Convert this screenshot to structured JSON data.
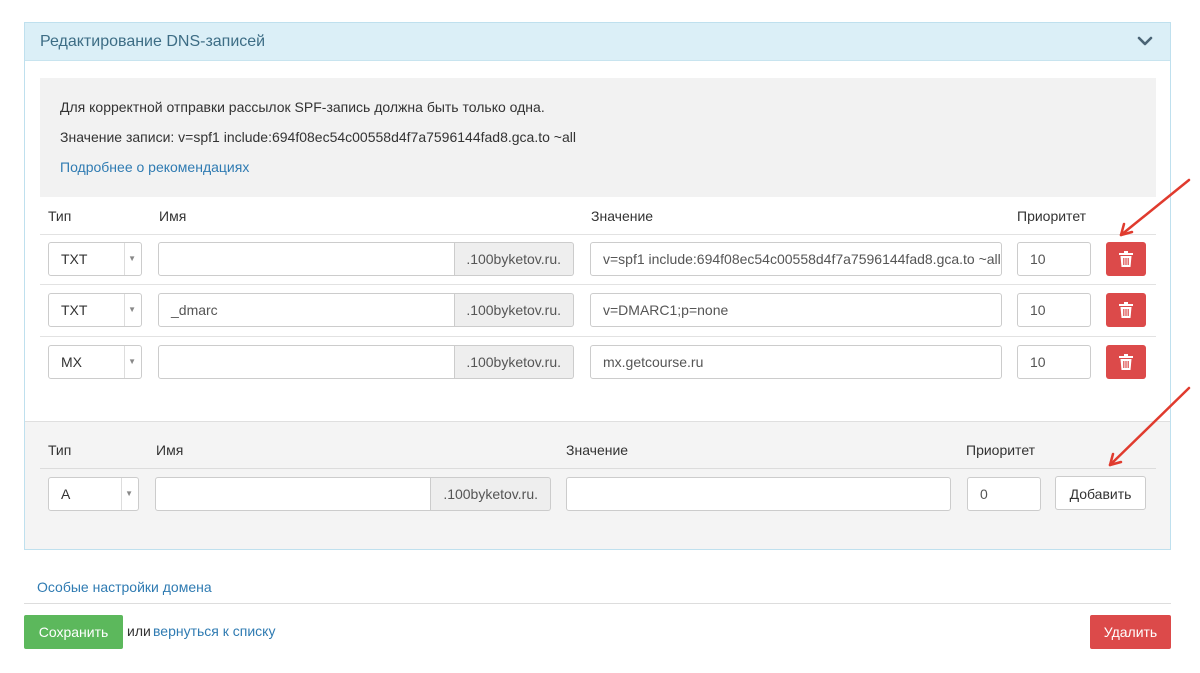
{
  "panel": {
    "title": "Редактирование DNS-записей"
  },
  "info": {
    "line1": "Для корректной отправки рассылок SPF-запись должна быть только одна.",
    "line2": "Значение записи: v=spf1 include:694f08ec54c00558d4f7a7596144fad8.gca.to ~all",
    "link": "Подробнее о рекомендациях"
  },
  "table": {
    "headers": {
      "type": "Тип",
      "name": "Имя",
      "value": "Значение",
      "priority": "Приоритет"
    },
    "domain_suffix": ".100byketov.ru.",
    "rows": [
      {
        "type": "TXT",
        "name": "",
        "value": "v=spf1 include:694f08ec54c00558d4f7a7596144fad8.gca.to ~all",
        "priority": "10"
      },
      {
        "type": "TXT",
        "name": "_dmarc",
        "value": "v=DMARC1;p=none",
        "priority": "10"
      },
      {
        "type": "MX",
        "name": "",
        "value": "mx.getcourse.ru",
        "priority": "10"
      }
    ]
  },
  "new_record": {
    "headers": {
      "type": "Тип",
      "name": "Имя",
      "value": "Значение",
      "priority": "Приоритет"
    },
    "type": "A",
    "name": "",
    "domain_suffix": ".100byketov.ru.",
    "value": "",
    "priority": "0",
    "add_label": "Добавить"
  },
  "footer": {
    "special_settings": "Особые настройки домена",
    "save_label": "Сохранить",
    "or_text": "или",
    "back_link": "вернуться к списку",
    "delete_label": "Удалить"
  },
  "colors": {
    "header_bg": "#dbeff7",
    "link": "#2f7bb2",
    "danger": "#dc4a4a",
    "success": "#5cb85c",
    "arrow": "#e03b2e"
  },
  "icons": {
    "collapse": "chevron-down-icon",
    "delete": "trash-icon"
  }
}
